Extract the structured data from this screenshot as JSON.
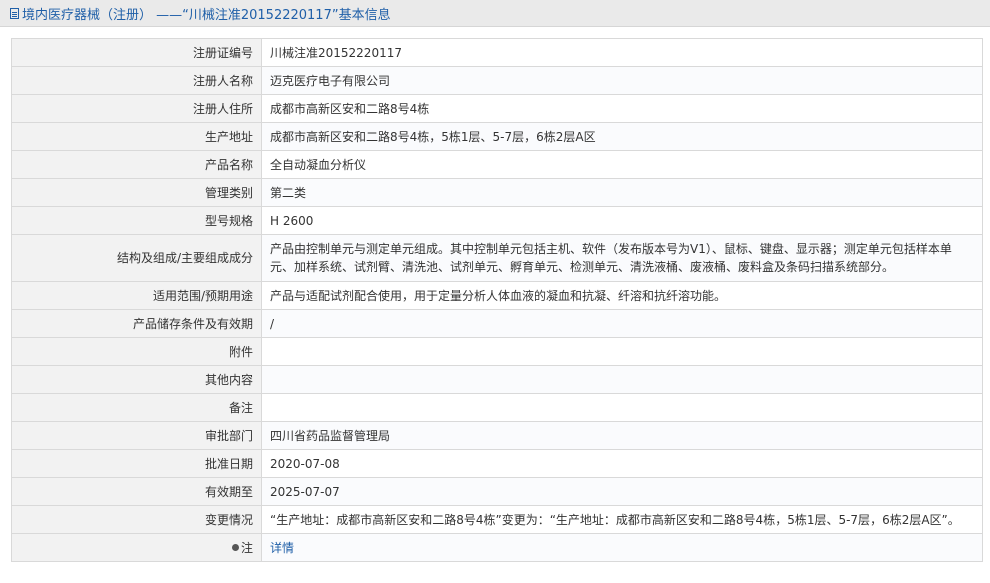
{
  "header": {
    "title": "境内医疗器械（注册） ——“川械注准20152220117”基本信息"
  },
  "rows": [
    {
      "label": "注册证编号",
      "value": "川械注准20152220117"
    },
    {
      "label": "注册人名称",
      "value": "迈克医疗电子有限公司"
    },
    {
      "label": "注册人住所",
      "value": "成都市高新区安和二路8号4栋"
    },
    {
      "label": "生产地址",
      "value": "成都市高新区安和二路8号4栋，5栋1层、5-7层，6栋2层A区"
    },
    {
      "label": "产品名称",
      "value": "全自动凝血分析仪"
    },
    {
      "label": "管理类别",
      "value": "第二类"
    },
    {
      "label": "型号规格",
      "value": "H 2600"
    },
    {
      "label": "结构及组成/主要组成成分",
      "value": "产品由控制单元与测定单元组成。其中控制单元包括主机、软件（发布版本号为V1）、鼠标、键盘、显示器；测定单元包括样本单元、加样系统、试剂臂、清洗池、试剂单元、孵育单元、检测单元、清洗液桶、废液桶、废料盒及条码扫描系统部分。"
    },
    {
      "label": "适用范围/预期用途",
      "value": "产品与适配试剂配合使用，用于定量分析人体血液的凝血和抗凝、纤溶和抗纤溶功能。"
    },
    {
      "label": "产品储存条件及有效期",
      "value": "/"
    },
    {
      "label": "附件",
      "value": ""
    },
    {
      "label": "其他内容",
      "value": ""
    },
    {
      "label": "备注",
      "value": ""
    },
    {
      "label": "审批部门",
      "value": "四川省药品监督管理局"
    },
    {
      "label": "批准日期",
      "value": "2020-07-08"
    },
    {
      "label": "有效期至",
      "value": "2025-07-07"
    },
    {
      "label": "变更情况",
      "value": "“生产地址：成都市高新区安和二路8号4栋”变更为：“生产地址：成都市高新区安和二路8号4栋，5栋1层、5-7层，6栋2层A区”。"
    },
    {
      "label": "注",
      "value": "详情"
    }
  ]
}
